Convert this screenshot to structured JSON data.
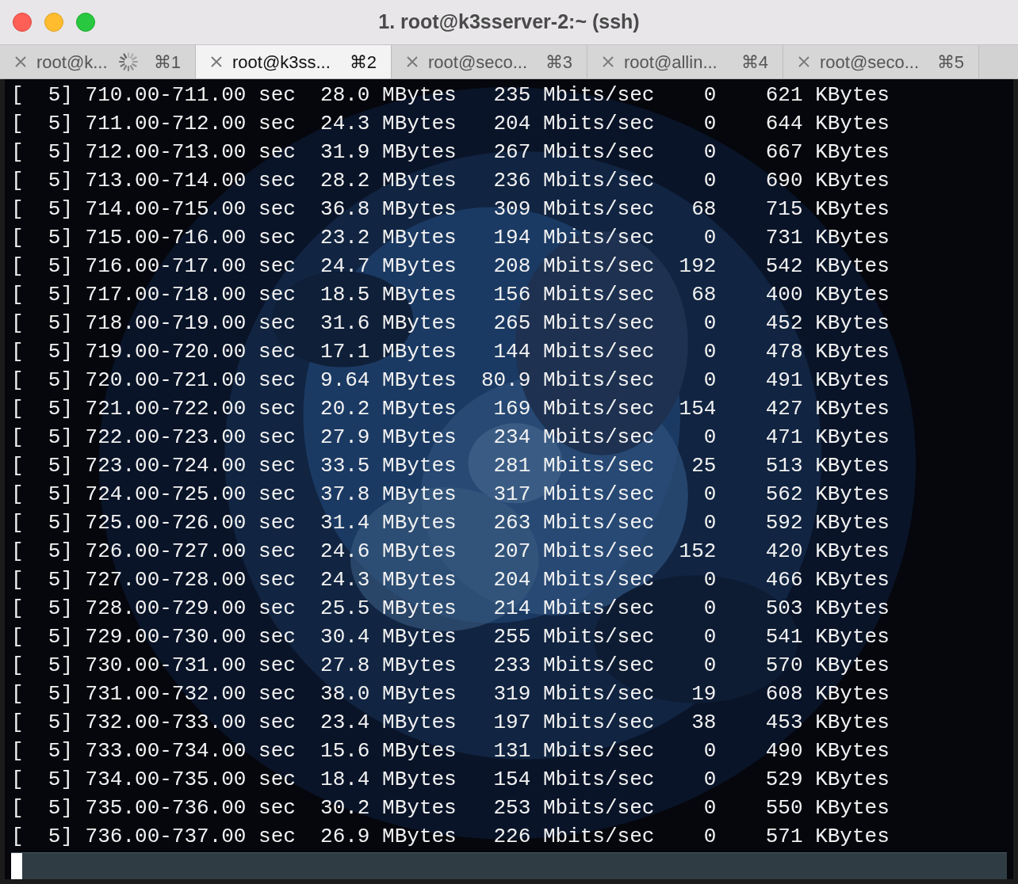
{
  "window": {
    "title": "1. root@k3sserver-2:~ (ssh)"
  },
  "tabs": [
    {
      "title": "root@k...",
      "shortcut": "⌘1",
      "selected": false,
      "busy": true
    },
    {
      "title": "root@k3ss...",
      "shortcut": "⌘2",
      "selected": true,
      "busy": false
    },
    {
      "title": "root@seco...",
      "shortcut": "⌘3",
      "selected": false,
      "busy": false
    },
    {
      "title": "root@allin...",
      "shortcut": "⌘4",
      "selected": false,
      "busy": false
    },
    {
      "title": "root@seco...",
      "shortcut": "⌘5",
      "selected": false,
      "busy": false
    }
  ],
  "terminal": {
    "lines": [
      "[  5] 710.00-711.00 sec  28.0 MBytes   235 Mbits/sec    0    621 KBytes",
      "[  5] 711.00-712.00 sec  24.3 MBytes   204 Mbits/sec    0    644 KBytes",
      "[  5] 712.00-713.00 sec  31.9 MBytes   267 Mbits/sec    0    667 KBytes",
      "[  5] 713.00-714.00 sec  28.2 MBytes   236 Mbits/sec    0    690 KBytes",
      "[  5] 714.00-715.00 sec  36.8 MBytes   309 Mbits/sec   68    715 KBytes",
      "[  5] 715.00-716.00 sec  23.2 MBytes   194 Mbits/sec    0    731 KBytes",
      "[  5] 716.00-717.00 sec  24.7 MBytes   208 Mbits/sec  192    542 KBytes",
      "[  5] 717.00-718.00 sec  18.5 MBytes   156 Mbits/sec   68    400 KBytes",
      "[  5] 718.00-719.00 sec  31.6 MBytes   265 Mbits/sec    0    452 KBytes",
      "[  5] 719.00-720.00 sec  17.1 MBytes   144 Mbits/sec    0    478 KBytes",
      "[  5] 720.00-721.00 sec  9.64 MBytes  80.9 Mbits/sec    0    491 KBytes",
      "[  5] 721.00-722.00 sec  20.2 MBytes   169 Mbits/sec  154    427 KBytes",
      "[  5] 722.00-723.00 sec  27.9 MBytes   234 Mbits/sec    0    471 KBytes",
      "[  5] 723.00-724.00 sec  33.5 MBytes   281 Mbits/sec   25    513 KBytes",
      "[  5] 724.00-725.00 sec  37.8 MBytes   317 Mbits/sec    0    562 KBytes",
      "[  5] 725.00-726.00 sec  31.4 MBytes   263 Mbits/sec    0    592 KBytes",
      "[  5] 726.00-727.00 sec  24.6 MBytes   207 Mbits/sec  152    420 KBytes",
      "[  5] 727.00-728.00 sec  24.3 MBytes   204 Mbits/sec    0    466 KBytes",
      "[  5] 728.00-729.00 sec  25.5 MBytes   214 Mbits/sec    0    503 KBytes",
      "[  5] 729.00-730.00 sec  30.4 MBytes   255 Mbits/sec    0    541 KBytes",
      "[  5] 730.00-731.00 sec  27.8 MBytes   233 Mbits/sec    0    570 KBytes",
      "[  5] 731.00-732.00 sec  38.0 MBytes   319 Mbits/sec   19    608 KBytes",
      "[  5] 732.00-733.00 sec  23.4 MBytes   197 Mbits/sec   38    453 KBytes",
      "[  5] 733.00-734.00 sec  15.6 MBytes   131 Mbits/sec    0    490 KBytes",
      "[  5] 734.00-735.00 sec  18.4 MBytes   154 Mbits/sec    0    529 KBytes",
      "[  5] 735.00-736.00 sec  30.2 MBytes   253 Mbits/sec    0    550 KBytes",
      "[  5] 736.00-737.00 sec  26.9 MBytes   226 Mbits/sec    0    571 KBytes"
    ]
  }
}
